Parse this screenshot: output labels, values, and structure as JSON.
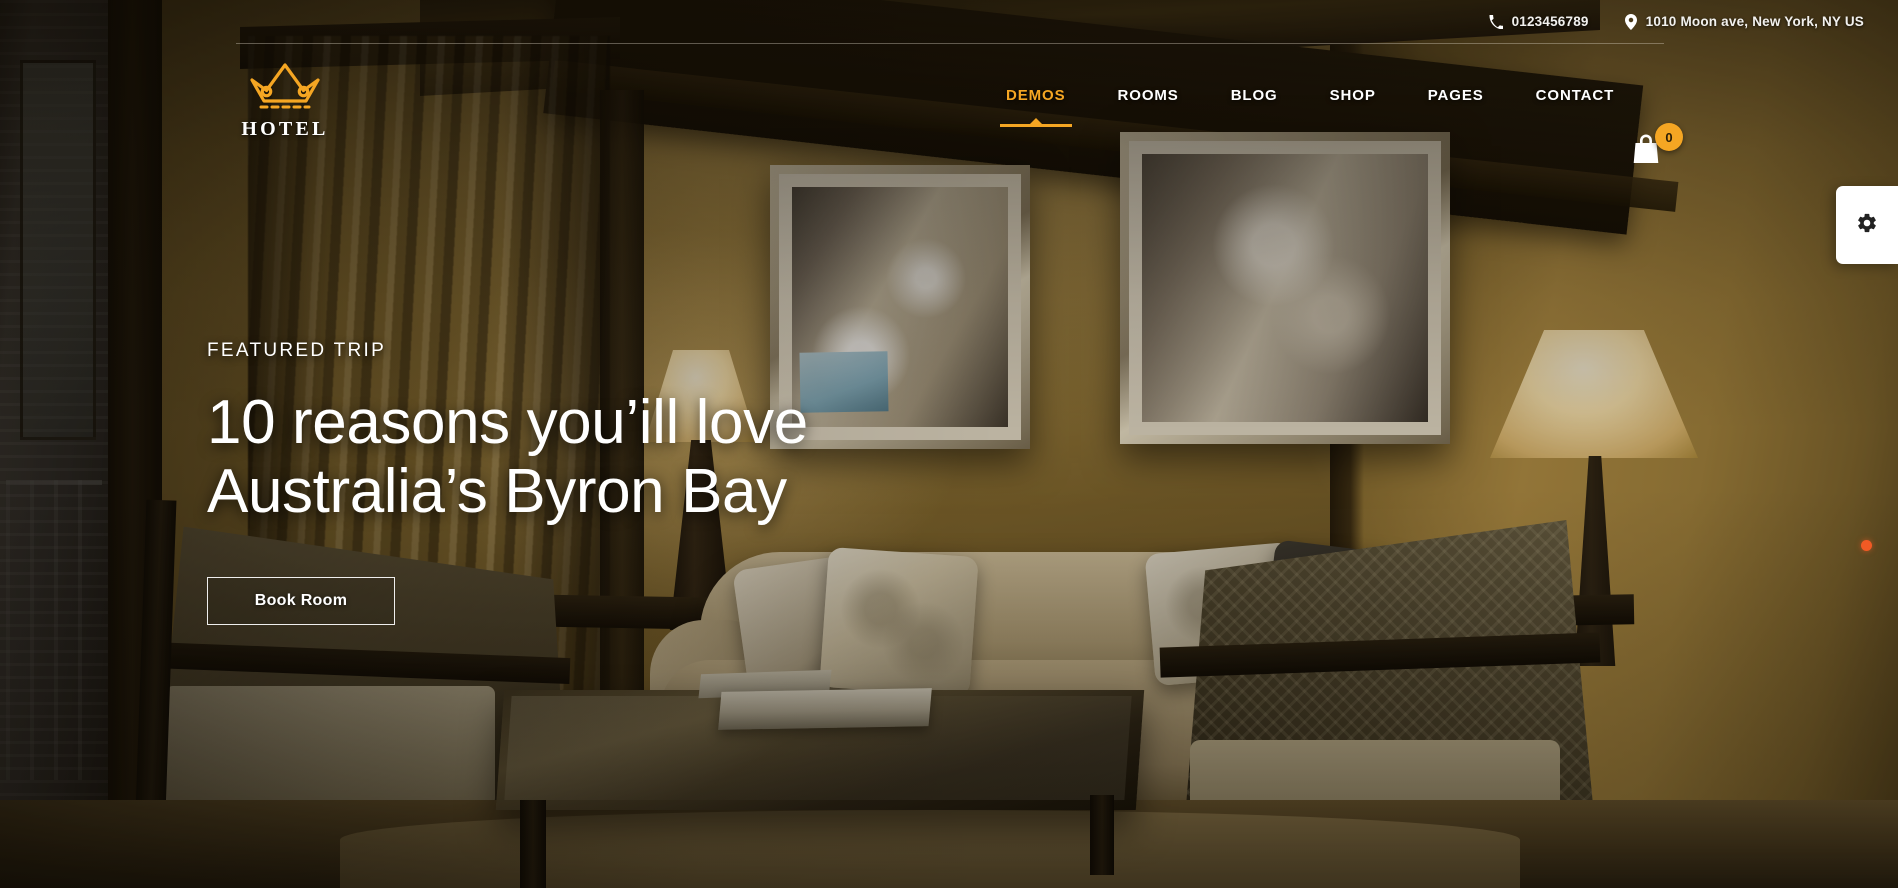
{
  "topbar": {
    "phone": "0123456789",
    "phone_icon": "phone-icon",
    "address": "1010 Moon ave, New York, NY US",
    "address_icon": "location-pin-icon"
  },
  "header": {
    "logo": {
      "icon": "crown-icon",
      "word": "HOTEL",
      "color": "#f5a623"
    },
    "nav": [
      {
        "label": "DEMOS",
        "active": true
      },
      {
        "label": "ROOMS",
        "active": false
      },
      {
        "label": "BLOG",
        "active": false
      },
      {
        "label": "SHOP",
        "active": false
      },
      {
        "label": "PAGES",
        "active": false
      },
      {
        "label": "CONTACT",
        "active": false
      }
    ],
    "cart": {
      "icon": "shopping-bag-icon",
      "count": "0",
      "badge_color": "#f5a623"
    }
  },
  "hero": {
    "eyebrow": "FEATURED TRIP",
    "headline_line1": "10 reasons you’ill love",
    "headline_line2": "Australia’s Byron Bay",
    "cta_label": "Book Room"
  },
  "sidebar": {
    "settings_icon": "gear-icon"
  },
  "slider": {
    "dot_color": "#f15a24",
    "active_index": "1"
  },
  "colors": {
    "accent": "#f5a623",
    "dot": "#f15a24",
    "text_light": "#ffffff"
  }
}
